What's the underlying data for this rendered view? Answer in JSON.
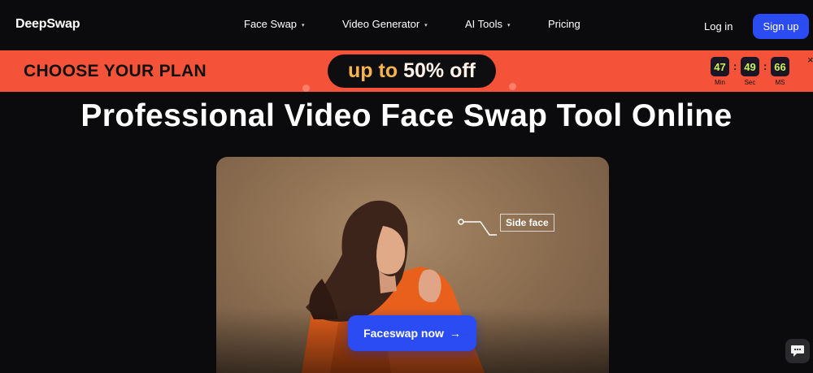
{
  "brand": {
    "logo": "DeepSwap"
  },
  "nav": {
    "items": [
      {
        "label": "Face Swap",
        "caret": "▾"
      },
      {
        "label": "Video Generator",
        "caret": "▾"
      },
      {
        "label": "AI Tools",
        "caret": "▾"
      },
      {
        "label": "Pricing"
      }
    ],
    "login": "Log in",
    "signup": "Sign up"
  },
  "promo": {
    "headline": "CHOOSE YOUR PLAN",
    "pill_a": "up to",
    "pill_b": "50% off",
    "countdown": [
      {
        "value": "47",
        "label": "Min"
      },
      {
        "value": "49",
        "label": "Sec"
      },
      {
        "value": "66",
        "label": "MS"
      }
    ],
    "separator": ":",
    "close": "×",
    "colors": {
      "background": "#f4533a",
      "pill": "#0e0e10",
      "accent": "#f7b44a"
    }
  },
  "hero": {
    "title": "Professional Video Face Swap Tool Online",
    "media_tag": "Side face",
    "cta_label": "Faceswap now",
    "cta_arrow": "→",
    "cta_color": "#2b4cf2"
  },
  "chat_widget": {
    "icon": "chat-bubble-icon"
  }
}
